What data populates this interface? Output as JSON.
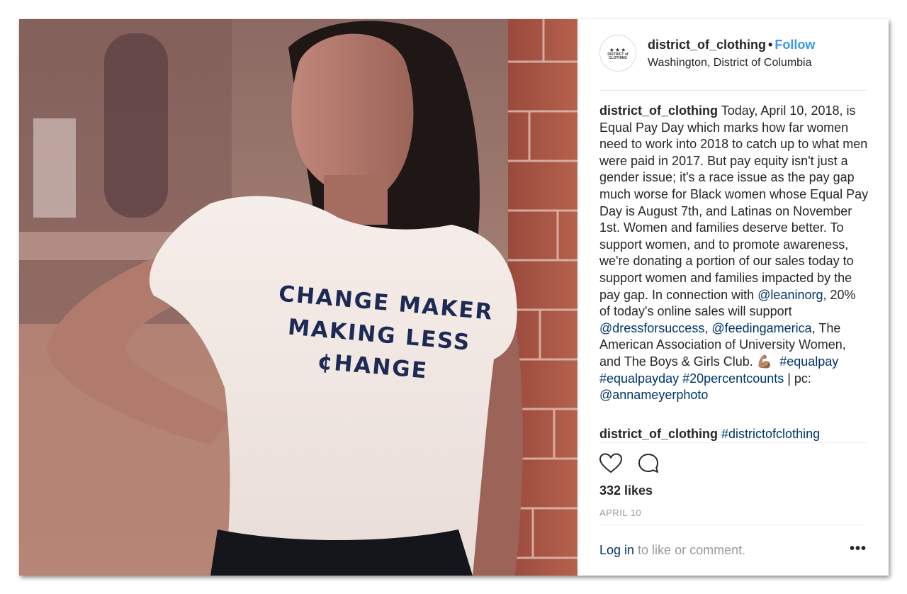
{
  "photo": {
    "shirt_lines": [
      "CHANGE MAKER",
      "MAKING LESS",
      "¢HANGE"
    ]
  },
  "header": {
    "avatar_stars": "★★★",
    "avatar_text": "DISTRICT of CLOTHING",
    "username": "district_of_clothing",
    "separator": "•",
    "follow_label": "Follow",
    "location": "Washington, District of Columbia"
  },
  "caption": {
    "username": "district_of_clothing",
    "text_1": "Today, April 10, 2018, is Equal Pay Day which marks how far women need to work into 2018 to catch up to what men were paid in 2017. But pay equity isn't just a gender issue; it's a race issue as the pay gap much worse for Black women whose Equal Pay Day is August 7th, and Latinas on November 1st. Women and families deserve better. To support women, and to promote awareness, we're donating a portion of our sales today to support women and families impacted by the pay gap. In connection with ",
    "mention_1": "@leaninorg",
    "text_2": ", 20% of today's online sales will support ",
    "mention_2": "@dressforsuccess",
    "text_3": ", ",
    "mention_3": "@feedingamerica",
    "text_4": ", The American Association of University Women, and The Boys & Girls Club. ",
    "emoji": "💪🏽",
    "text_5": "  ",
    "hashtag_1": "#equalpay",
    "text_6": " ",
    "hashtag_2": "#equalpayday",
    "text_7": " ",
    "hashtag_3": "#20percentcounts",
    "text_8": " | pc: ",
    "mention_4": "@annameyerphoto"
  },
  "comment": {
    "username": "district_of_clothing",
    "hashtag": "#districtofclothing"
  },
  "actions": {
    "like_icon": "heart-outline-icon",
    "comment_icon": "speech-bubble-icon"
  },
  "likes_text": "332 likes",
  "date_text": "APRIL 10",
  "footer": {
    "login_link": "Log in",
    "login_text": " to like or comment.",
    "more_label": "•••"
  },
  "colors": {
    "follow": "#3897f0",
    "link": "#003569",
    "muted": "#999999",
    "shirt_text": "#1c2a55"
  }
}
